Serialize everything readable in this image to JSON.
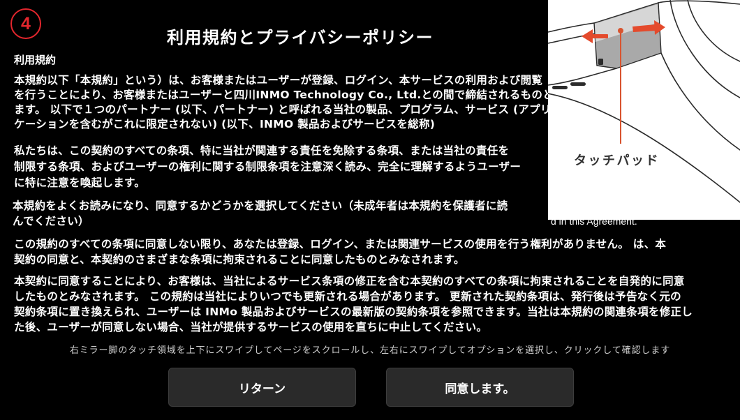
{
  "step_badge": "4",
  "title": "利用規約とプライバシーポリシー",
  "section_label": "利用規約",
  "paragraphs": [
    {
      "lines": [
        "本規約以下「本規約」という）は、お客様またはユーザーが登録、ログイン、本サービスの利用および閲覧",
        "を行うことにより、お客様またはユーザーと四川INMO Technology Co., Ltd.との間で締結されるものとし",
        "ます。 以下で１つのパートナー (以下、パートナー) と呼ばれる当社の製品、プログラム、サービス (アプリ",
        "ケーションを含むがこれに限定されない) (以下、INMO 製品およびサービスを総称)"
      ]
    },
    {
      "lines": [
        "私たちは、この契約のすべての条項、特に当社が関連する責任を免除する条項、または当社の責任を",
        "制限する条項、およびユーザーの権利に関する制限条項を注意深く読み、完全に理解するようユーザー",
        "に特に注意を喚起します。"
      ]
    },
    {
      "lines": [
        "本規約をよくお読みになり、同意するかどうかを選択してください（未成年者は本規約を保護者に読",
        "んでください）"
      ]
    },
    {
      "lines": [
        "この規約のすべての条項に同意しない限り、あなたは登録、ログイン、または関連サービスの使用を行う権利がありません。 は、本",
        "契約の同意と、本契約のさまざまな条項に拘束されることに同意したものとみなされます。"
      ]
    },
    {
      "lines": [
        "本契約に同意することにより、お客様は、当社によるサービス条項の修正を含む本契約のすべての条項に拘束されることを自発的に同意",
        "したものとみなされます。 この規約は当社によりいつでも更新される場合があります。 更新された契約条項は、発行後は予告なく元の",
        "契約条項に置き換えられ、ユーザーは INMo 製品およびサービスの最新版の契約条項を参照できます。当社は本規約の関連条項を修正し",
        "た後、ユーザーが同意しない場合、当社が提供するサービスの使用を直ちに中止してください。"
      ]
    }
  ],
  "background_fragment": "d in this Agreement.",
  "illustration": {
    "icon": "glasses-temple-touchpad-illustration",
    "label": "タッチパッド"
  },
  "instruction": "右ミラー脚のタッチ領域を上下にスワイプしてページをスクロールし、左右にスワイプしてオプションを選択し、クリックして確認します",
  "buttons": {
    "return_label": "リターン",
    "agree_label": "同意します。"
  },
  "colors": {
    "background": "#000000",
    "text": "#ffffff",
    "accent": "#e3262d",
    "arrow": "#e44a2c",
    "button_background": "#2a2a2a",
    "instruction_text": "#cfcfcf"
  }
}
